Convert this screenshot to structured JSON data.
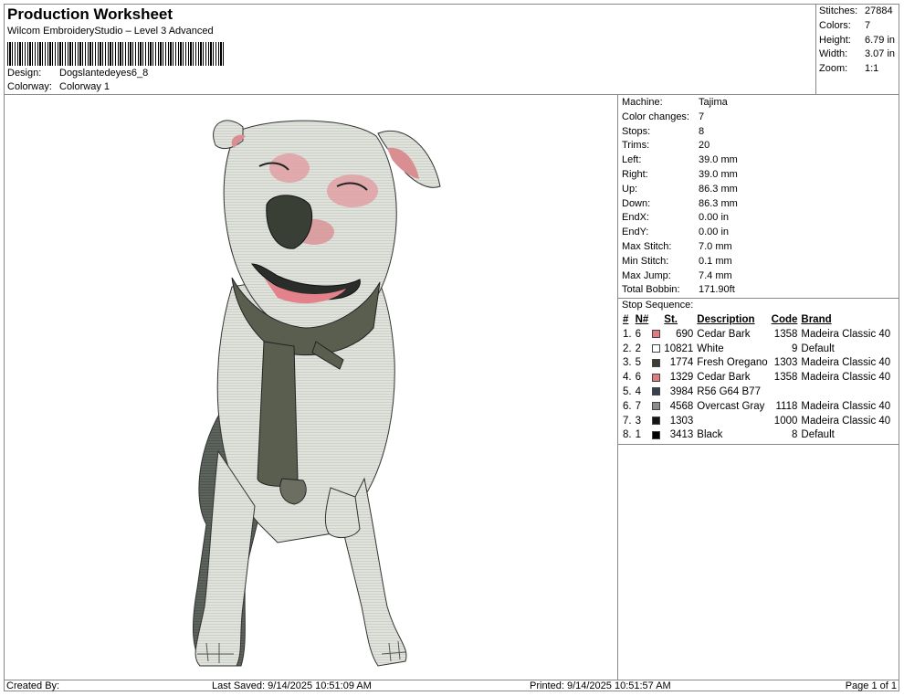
{
  "header": {
    "title": "Production Worksheet",
    "software": "Wilcom EmbroideryStudio – Level 3 Advanced",
    "design_label": "Design:",
    "design_value": "Dogslantedeyes6_8",
    "colorway_label": "Colorway:",
    "colorway_value": "Colorway 1"
  },
  "summary": {
    "stitches_label": "Stitches:",
    "stitches": "27884",
    "colors_label": "Colors:",
    "colors": "7",
    "height_label": "Height:",
    "height": "6.79 in",
    "width_label": "Width:",
    "width": "3.07 in",
    "zoom_label": "Zoom:",
    "zoom": "1:1"
  },
  "specs": [
    {
      "label": "Machine:",
      "value": "Tajima"
    },
    {
      "label": "Color changes:",
      "value": "7"
    },
    {
      "label": "Stops:",
      "value": "8"
    },
    {
      "label": "Trims:",
      "value": "20"
    },
    {
      "label": "Left:",
      "value": "39.0 mm"
    },
    {
      "label": "Right:",
      "value": "39.0 mm"
    },
    {
      "label": "Up:",
      "value": "86.3 mm"
    },
    {
      "label": "Down:",
      "value": "86.3 mm"
    },
    {
      "label": "EndX:",
      "value": "0.00 in"
    },
    {
      "label": "EndY:",
      "value": "0.00 in"
    },
    {
      "label": "Max Stitch:",
      "value": "7.0 mm"
    },
    {
      "label": "Min Stitch:",
      "value": "0.1 mm"
    },
    {
      "label": "Max Jump:",
      "value": "7.4 mm"
    },
    {
      "label": "Total Bobbin:",
      "value": "171.90ft"
    }
  ],
  "stop_sequence": {
    "title": "Stop Sequence:",
    "columns": {
      "idx": "#",
      "needle": "N#",
      "stitches": "St.",
      "description": "Description",
      "code": "Code",
      "brand": "Brand"
    },
    "rows": [
      {
        "idx": "1.",
        "needle": "6",
        "color": "#e07a80",
        "stitches": "690",
        "description": "Cedar Bark",
        "code": "1358",
        "brand": "Madeira Classic 40"
      },
      {
        "idx": "2.",
        "needle": "2",
        "color": "#ffffff",
        "stitches": "10821",
        "description": "White",
        "code": "9",
        "brand": "Default"
      },
      {
        "idx": "3.",
        "needle": "5",
        "color": "#3a3f36",
        "stitches": "1774",
        "description": "Fresh Oregano",
        "code": "1303",
        "brand": "Madeira Classic 40"
      },
      {
        "idx": "4.",
        "needle": "6",
        "color": "#e07a80",
        "stitches": "1329",
        "description": "Cedar Bark",
        "code": "1358",
        "brand": "Madeira Classic 40"
      },
      {
        "idx": "5.",
        "needle": "4",
        "color": "#38404d",
        "stitches": "3984",
        "description": "R56 G64 B77",
        "code": "",
        "brand": ""
      },
      {
        "idx": "6.",
        "needle": "7",
        "color": "#8c8c8c",
        "stitches": "4568",
        "description": "Overcast Gray",
        "code": "1118",
        "brand": "Madeira Classic 40"
      },
      {
        "idx": "7.",
        "needle": "3",
        "color": "#141414",
        "stitches": "1303",
        "description": "",
        "code": "1000",
        "brand": "Madeira Classic 40"
      },
      {
        "idx": "8.",
        "needle": "1",
        "color": "#000000",
        "stitches": "3413",
        "description": "Black",
        "code": "8",
        "brand": "Default"
      }
    ]
  },
  "footer": {
    "created_by": "Created By:",
    "last_saved": "Last Saved: 9/14/2025 10:51:09 AM",
    "printed": "Printed: 9/14/2025 10:51:57 AM",
    "page": "Page 1 of 1"
  }
}
